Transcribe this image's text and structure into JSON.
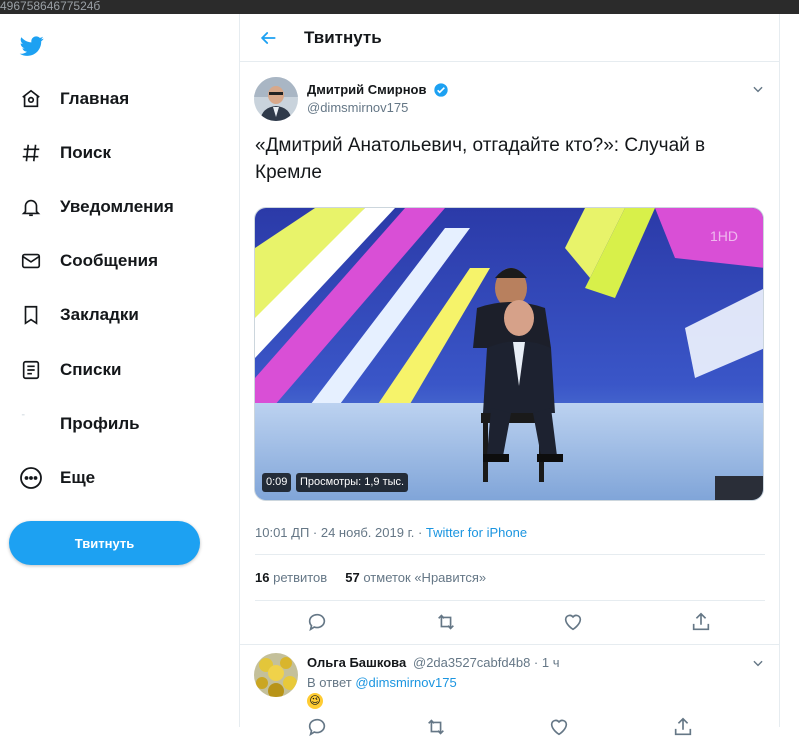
{
  "browser": {
    "url_fragment": "49675864677524б"
  },
  "nav": {
    "items": [
      {
        "label": "Главная",
        "icon": "home-icon"
      },
      {
        "label": "Поиск",
        "icon": "hashtag-icon"
      },
      {
        "label": "Уведомления",
        "icon": "bell-icon"
      },
      {
        "label": "Сообщения",
        "icon": "envelope-icon"
      },
      {
        "label": "Закладки",
        "icon": "bookmark-icon"
      },
      {
        "label": "Списки",
        "icon": "list-icon"
      },
      {
        "label": "Профиль",
        "icon": "profile-icon"
      },
      {
        "label": "Еще",
        "icon": "more-icon"
      }
    ],
    "tweet_button": "Твитнуть"
  },
  "header": {
    "title": "Твитнуть"
  },
  "tweet": {
    "author_name": "Дмитрий Смирнов",
    "author_handle": "@dimsmirnov175",
    "text": "«Дмитрий Анатольевич, отгадайте кто?»: Случай в Кремле",
    "video": {
      "duration": "0:09",
      "views": "Просмотры: 1,9 тыс.",
      "watermark": "1HD"
    },
    "time": "10:01 ДП · 24 нояб. 2019 г.",
    "separator": " · ",
    "source": "Twitter for iPhone",
    "retweets_count": "16",
    "retweets_label": "ретвитов",
    "likes_count": "57",
    "likes_label": "отметок «Нравится»"
  },
  "reply": {
    "author_name": "Ольга Башкова",
    "author_handle": "@2da3527cabfd4b8 · 1 ч",
    "reply_prefix": "В ответ",
    "reply_to": "@dimsmirnov175",
    "emoji": "😉"
  },
  "colors": {
    "accent": "#1da1f2",
    "link": "#1b95e0",
    "muted": "#657786",
    "border": "#e6ecf0"
  }
}
